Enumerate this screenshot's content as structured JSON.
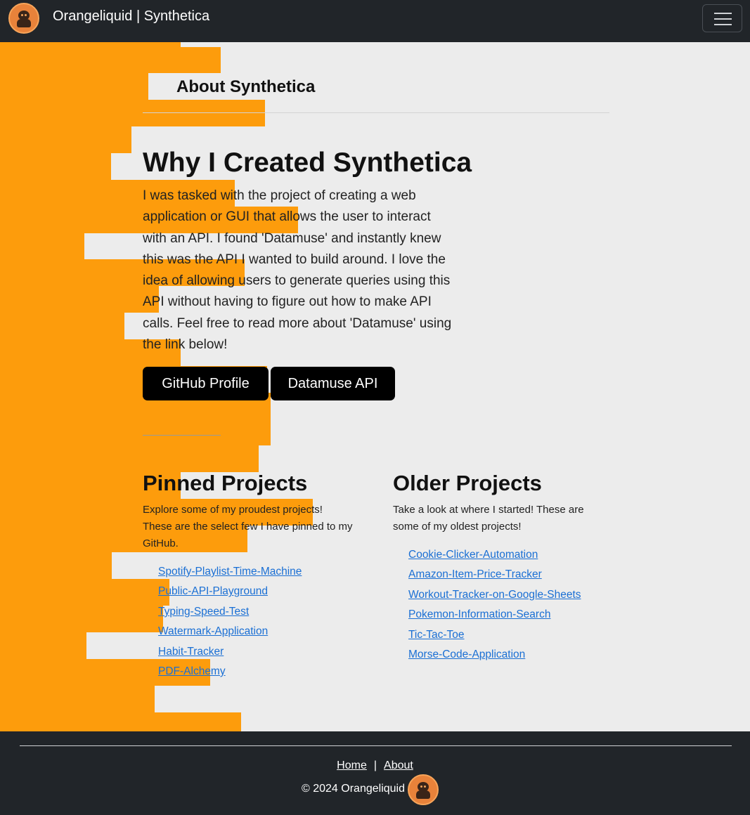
{
  "navbar": {
    "logo_icon": "orangeliquid-logo-icon",
    "brand": "Orangeliquid | Synthetica",
    "toggler_icon": "hamburger-menu-icon"
  },
  "colors": {
    "navbar_bg": "#212529",
    "accent_orange": "#fd9c0c",
    "page_bg": "#ececec",
    "link": "#1a6fd4",
    "button_bg": "#000000"
  },
  "main": {
    "heading": "About Synthetica",
    "why_title": "Why I Created Synthetica",
    "why_text": "I was tasked with the project of creating a web application or GUI that allows the user to interact with an API. I found 'Datamuse' and instantly knew this was the API I wanted to build around. I love the idea of allowing users to generate queries using this API without having to figure out how to make API calls. Feel free to read more about 'Datamuse' using the link below!",
    "buttons": {
      "github": "GitHub Profile",
      "datamuse": "Datamuse API"
    }
  },
  "pinned": {
    "title": "Pinned Projects",
    "description": "Explore some of my proudest projects! These are the select few I have pinned to my GitHub.",
    "links": [
      "Spotify-Playlist-Time-Machine",
      "Public-API-Playground",
      "Typing-Speed-Test",
      "Watermark-Application",
      "Habit-Tracker",
      "PDF-Alchemy"
    ]
  },
  "older": {
    "title": "Older Projects",
    "description": "Take a look at where I started! These are some of my oldest projects!",
    "links": [
      "Cookie-Clicker-Automation",
      "Amazon-Item-Price-Tracker",
      "Workout-Tracker-on-Google-Sheets",
      "Pokemon-Information-Search",
      "Tic-Tac-Toe",
      "Morse-Code-Application"
    ]
  },
  "footer": {
    "home": "Home",
    "separator": "|",
    "about": "About",
    "copyright": "© 2024 Orangeliquid",
    "logo_icon": "orangeliquid-logo-icon"
  }
}
